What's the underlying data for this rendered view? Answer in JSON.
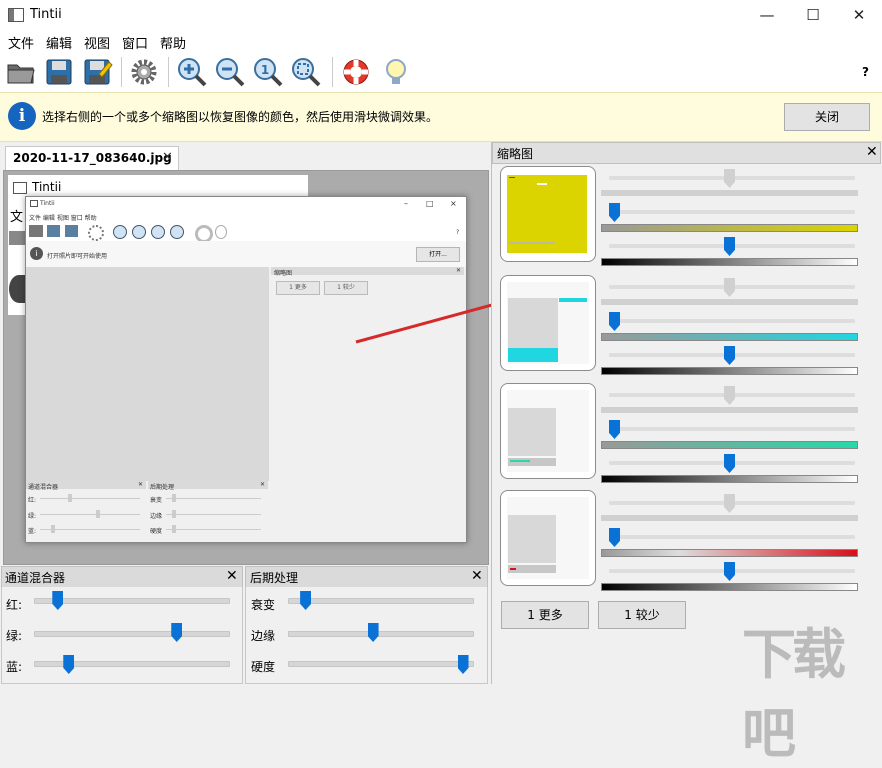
{
  "window": {
    "title": "Tintii",
    "minimize": "—",
    "maximize": "☐",
    "close": "✕"
  },
  "menu": [
    {
      "label": "文件"
    },
    {
      "label": "编辑"
    },
    {
      "label": "视图"
    },
    {
      "label": "窗口"
    },
    {
      "label": "帮助"
    }
  ],
  "toolbar": {
    "help": "?"
  },
  "info": {
    "message": "选择右侧的一个或多个缩略图以恢复图像的颜色，然后使用滑块微调效果。",
    "close_label": "关闭"
  },
  "tab": {
    "label": "2020-11-17_083640.jpg",
    "close": "✕"
  },
  "behind": {
    "title": "Tintii",
    "menu_partial": "文"
  },
  "mini": {
    "title": "Tintii",
    "menu": "文件  编辑  视图  窗口  帮助",
    "info": "打开照片即可开始使用",
    "open_label": "打开...",
    "thumbs_title": "缩略图",
    "more": "1 更多",
    "fewer": "1 较少",
    "mixer_title": "通道混合器",
    "mixer_labels": [
      "红:",
      "绿:",
      "蓝:"
    ],
    "post_title": "后期处理",
    "post_labels": [
      "衰变",
      "边缘",
      "硬度"
    ],
    "help": "?",
    "close": "✕"
  },
  "mixer": {
    "title": "通道混合器",
    "close": "✕",
    "sliders": [
      {
        "label": "红:",
        "value": 0.1
      },
      {
        "label": "绿:",
        "value": 0.75
      },
      {
        "label": "蓝:",
        "value": 0.16
      }
    ]
  },
  "post": {
    "title": "后期处理",
    "close": "✕",
    "sliders": [
      {
        "label": "衰变",
        "value": 0.07
      },
      {
        "label": "边缘",
        "value": 0.46
      },
      {
        "label": "硬度",
        "value": 0.98
      }
    ]
  },
  "thumbs": {
    "title": "缩略图",
    "close": "✕",
    "tint_colors": [
      "#dbd400",
      "#20d6e0",
      "#25d9a8",
      "#d8101a"
    ],
    "more_label": "1 更多",
    "fewer_label": "1 较少"
  },
  "watermark": "下载吧",
  "colors": {
    "arrow": "#d42a2a",
    "slider_blue": "#0a72d6",
    "info_bg": "#fffbdd"
  }
}
